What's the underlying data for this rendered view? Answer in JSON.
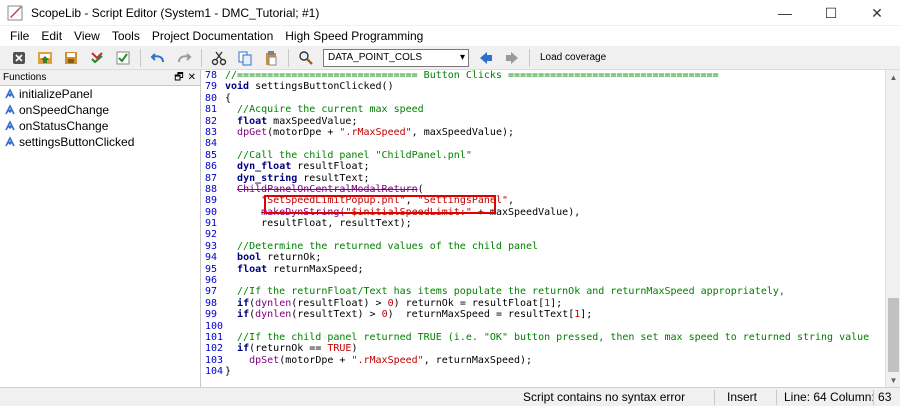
{
  "window": {
    "title": "ScopeLib - Script Editor (System1 - DMC_Tutorial; #1)",
    "controls": [
      "—",
      "☐",
      "✕"
    ]
  },
  "menu": [
    "File",
    "Edit",
    "View",
    "Tools",
    "Project Documentation",
    "High Speed Programming"
  ],
  "toolbar": {
    "buttons": [
      "close-icon",
      "save-icon",
      "save-as-icon",
      "check-icon",
      "verify-icon",
      "undo-icon",
      "redo-icon",
      "cut-icon",
      "copy-icon",
      "paste-icon",
      "find-icon"
    ],
    "select_value": "DATA_POINT_COLS",
    "load_coverage": "Load coverage",
    "colors": {
      "back_arrow": "#2f6fc9",
      "forward_arrow": "#9a9a9a"
    }
  },
  "functions_panel": {
    "title": "Functions",
    "ctrl_float": "🗗",
    "ctrl_close": "✕",
    "items": [
      "initializePanel",
      "onSpeedChange",
      "onStatusChange",
      "settingsButtonClicked"
    ]
  },
  "editor": {
    "lines": [
      {
        "n": "78",
        "parts": [
          [
            "//============================== Button Clicks ===================================",
            "comment"
          ]
        ]
      },
      {
        "n": "79",
        "parts": [
          [
            "void",
            "kw"
          ],
          [
            " settingsButtonClicked()",
            "plain"
          ]
        ]
      },
      {
        "n": "80",
        "parts": [
          [
            "{",
            "plain"
          ]
        ]
      },
      {
        "n": "81",
        "parts": [
          [
            "  //Acquire the current max speed",
            "comment"
          ]
        ]
      },
      {
        "n": "82",
        "parts": [
          [
            "  ",
            "plain"
          ],
          [
            "float",
            "kw"
          ],
          [
            " maxSpeedValue;",
            "plain"
          ]
        ]
      },
      {
        "n": "83",
        "parts": [
          [
            "  ",
            "plain"
          ],
          [
            "dpGet",
            "fn"
          ],
          [
            "(motorDpe + ",
            "plain"
          ],
          [
            "\".rMaxSpeed\"",
            "str"
          ],
          [
            ", maxSpeedValue);",
            "plain"
          ]
        ]
      },
      {
        "n": "84",
        "parts": [
          [
            "",
            "plain"
          ]
        ]
      },
      {
        "n": "85",
        "parts": [
          [
            "  //Call the child panel \"ChildPanel.pnl\"",
            "comment"
          ]
        ]
      },
      {
        "n": "86",
        "parts": [
          [
            "  ",
            "plain"
          ],
          [
            "dyn_float",
            "kw"
          ],
          [
            " resultFloat;",
            "plain"
          ]
        ]
      },
      {
        "n": "87",
        "parts": [
          [
            "  ",
            "plain"
          ],
          [
            "dyn_string",
            "kw"
          ],
          [
            " resultText;",
            "plain"
          ]
        ]
      },
      {
        "n": "88",
        "parts": [
          [
            "  ",
            "plain"
          ],
          [
            "ChildPanelOnCentralModalReturn",
            "fn-strike"
          ],
          [
            "(",
            "plain"
          ]
        ]
      },
      {
        "n": "89",
        "parts": [
          [
            "      ",
            "plain"
          ],
          [
            "\"SetSpeedLimitPopup.pnl\"",
            "str"
          ],
          [
            ", ",
            "plain"
          ],
          [
            "\"SettingsPanel\"",
            "str"
          ],
          [
            ",",
            "plain"
          ]
        ]
      },
      {
        "n": "90",
        "parts": [
          [
            "      ",
            "plain"
          ],
          [
            "makeDynString(",
            "fn-strike"
          ],
          [
            "\"$initialSpeedLimit:\"",
            "str"
          ],
          [
            " + maxSpeedValue),",
            "plain"
          ]
        ]
      },
      {
        "n": "91",
        "parts": [
          [
            "      resultFloat, resultText);",
            "plain"
          ]
        ]
      },
      {
        "n": "92",
        "parts": [
          [
            "",
            "plain"
          ]
        ]
      },
      {
        "n": "93",
        "parts": [
          [
            "  //Determine the returned values of the child panel",
            "comment"
          ]
        ]
      },
      {
        "n": "94",
        "parts": [
          [
            "  ",
            "plain"
          ],
          [
            "bool",
            "kw"
          ],
          [
            " returnOk;",
            "plain"
          ]
        ]
      },
      {
        "n": "95",
        "parts": [
          [
            "  ",
            "plain"
          ],
          [
            "float",
            "kw"
          ],
          [
            " returnMaxSpeed;",
            "plain"
          ]
        ]
      },
      {
        "n": "96",
        "parts": [
          [
            "",
            "plain"
          ]
        ]
      },
      {
        "n": "97",
        "parts": [
          [
            "  //If the returnFloat/Text has items populate the returnOk and returnMaxSpeed appropriately,",
            "comment"
          ]
        ]
      },
      {
        "n": "98",
        "parts": [
          [
            "  ",
            "plain"
          ],
          [
            "if",
            "kw"
          ],
          [
            "(",
            "plain"
          ],
          [
            "dynlen",
            "fn"
          ],
          [
            "(resultFloat) > ",
            "plain"
          ],
          [
            "0",
            "num"
          ],
          [
            ") returnOk = resultFloat[",
            "plain"
          ],
          [
            "1",
            "num"
          ],
          [
            "];",
            "plain"
          ]
        ]
      },
      {
        "n": "99",
        "parts": [
          [
            "  ",
            "plain"
          ],
          [
            "if",
            "kw"
          ],
          [
            "(",
            "plain"
          ],
          [
            "dynlen",
            "fn"
          ],
          [
            "(resultText) > ",
            "plain"
          ],
          [
            "0",
            "num"
          ],
          [
            ")  returnMaxSpeed = resultText[",
            "plain"
          ],
          [
            "1",
            "num"
          ],
          [
            "];",
            "plain"
          ]
        ]
      },
      {
        "n": "100",
        "parts": [
          [
            "",
            "plain"
          ]
        ]
      },
      {
        "n": "101",
        "parts": [
          [
            "  //If the child panel returned TRUE (i.e. \"OK\" button pressed, then set max speed to returned string value",
            "comment"
          ]
        ]
      },
      {
        "n": "102",
        "parts": [
          [
            "  ",
            "plain"
          ],
          [
            "if",
            "kw"
          ],
          [
            "(returnOk == ",
            "plain"
          ],
          [
            "TRUE",
            "str"
          ],
          [
            ")",
            "plain"
          ]
        ]
      },
      {
        "n": "103",
        "parts": [
          [
            "    ",
            "plain"
          ],
          [
            "dpSet",
            "fn"
          ],
          [
            "(motorDpe + ",
            "plain"
          ],
          [
            "\".rMaxSpeed\"",
            "str"
          ],
          [
            ", returnMaxSpeed);",
            "plain"
          ]
        ]
      },
      {
        "n": "104",
        "parts": [
          [
            "}",
            "plain"
          ]
        ]
      }
    ]
  },
  "status": {
    "message": "Script contains no syntax error",
    "mode": "Insert",
    "position": "Line: 64 Column: 63"
  }
}
